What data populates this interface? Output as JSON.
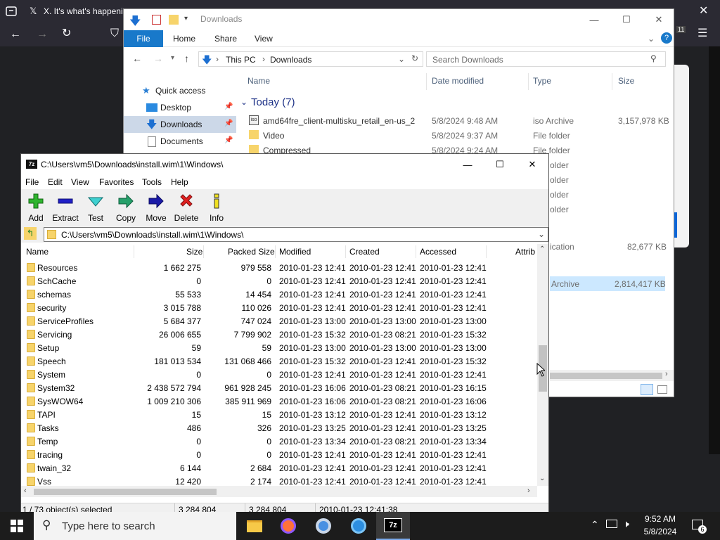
{
  "browser": {
    "tab_title": "X. It's what's happenin",
    "badge_count": "11"
  },
  "explorer": {
    "title": "Downloads",
    "ribbon_tabs": [
      "File",
      "Home",
      "Share",
      "View"
    ],
    "address": [
      "This PC",
      "Downloads"
    ],
    "search_placeholder": "Search Downloads",
    "nav": [
      "Quick access",
      "Desktop",
      "Downloads",
      "Documents"
    ],
    "columns": [
      "Name",
      "Date modified",
      "Type",
      "Size"
    ],
    "group_label": "Today (7)",
    "rows": [
      {
        "name": "amd64fre_client-multisku_retail_en-us_2",
        "date": "5/8/2024 9:48 AM",
        "type": "iso Archive",
        "size": "3,157,978 KB"
      },
      {
        "name": "Video",
        "date": "5/8/2024 9:37 AM",
        "type": "File folder",
        "size": ""
      },
      {
        "name": "Compressed",
        "date": "5/8/2024 9:24 AM",
        "type": "File folder",
        "size": ""
      }
    ],
    "partial_types": [
      "older",
      "older",
      "older",
      "older"
    ],
    "partial_rows": [
      {
        "type": "ication",
        "size": "82,677 KB"
      },
      {
        "type": "Archive",
        "size": "2,814,417 KB"
      }
    ]
  },
  "sevenzip": {
    "title": "C:\\Users\\vm5\\Downloads\\install.wim\\1\\Windows\\",
    "menu": [
      "File",
      "Edit",
      "View",
      "Favorites",
      "Tools",
      "Help"
    ],
    "toolbar": [
      "Add",
      "Extract",
      "Test",
      "Copy",
      "Move",
      "Delete",
      "Info"
    ],
    "address": "C:\\Users\\vm5\\Downloads\\install.wim\\1\\Windows\\",
    "columns": [
      "Name",
      "Size",
      "Packed Size",
      "Modified",
      "Created",
      "Accessed",
      "Attrib"
    ],
    "rows": [
      {
        "name": "Resources",
        "size": "1 662 275",
        "packed": "979 558",
        "modified": "2010-01-23 12:41",
        "created": "2010-01-23 12:41",
        "accessed": "2010-01-23 12:41"
      },
      {
        "name": "SchCache",
        "size": "0",
        "packed": "0",
        "modified": "2010-01-23 12:41",
        "created": "2010-01-23 12:41",
        "accessed": "2010-01-23 12:41"
      },
      {
        "name": "schemas",
        "size": "55 533",
        "packed": "14 454",
        "modified": "2010-01-23 12:41",
        "created": "2010-01-23 12:41",
        "accessed": "2010-01-23 12:41"
      },
      {
        "name": "security",
        "size": "3 015 788",
        "packed": "110 026",
        "modified": "2010-01-23 12:41",
        "created": "2010-01-23 12:41",
        "accessed": "2010-01-23 12:41"
      },
      {
        "name": "ServiceProfiles",
        "size": "5 684 377",
        "packed": "747 024",
        "modified": "2010-01-23 13:00",
        "created": "2010-01-23 13:00",
        "accessed": "2010-01-23 13:00"
      },
      {
        "name": "Servicing",
        "size": "26 006 655",
        "packed": "7 799 902",
        "modified": "2010-01-23 15:32",
        "created": "2010-01-23 08:21",
        "accessed": "2010-01-23 15:32"
      },
      {
        "name": "Setup",
        "size": "59",
        "packed": "59",
        "modified": "2010-01-23 13:00",
        "created": "2010-01-23 13:00",
        "accessed": "2010-01-23 13:00"
      },
      {
        "name": "Speech",
        "size": "181 013 534",
        "packed": "131 068 466",
        "modified": "2010-01-23 15:32",
        "created": "2010-01-23 12:41",
        "accessed": "2010-01-23 15:32"
      },
      {
        "name": "System",
        "size": "0",
        "packed": "0",
        "modified": "2010-01-23 12:41",
        "created": "2010-01-23 12:41",
        "accessed": "2010-01-23 12:41"
      },
      {
        "name": "System32",
        "size": "2 438 572 794",
        "packed": "961 928 245",
        "modified": "2010-01-23 16:06",
        "created": "2010-01-23 08:21",
        "accessed": "2010-01-23 16:15"
      },
      {
        "name": "SysWOW64",
        "size": "1 009 210 306",
        "packed": "385 911 969",
        "modified": "2010-01-23 16:06",
        "created": "2010-01-23 08:21",
        "accessed": "2010-01-23 16:06"
      },
      {
        "name": "TAPI",
        "size": "15",
        "packed": "15",
        "modified": "2010-01-23 13:12",
        "created": "2010-01-23 12:41",
        "accessed": "2010-01-23 13:12"
      },
      {
        "name": "Tasks",
        "size": "486",
        "packed": "326",
        "modified": "2010-01-23 13:25",
        "created": "2010-01-23 12:41",
        "accessed": "2010-01-23 13:25"
      },
      {
        "name": "Temp",
        "size": "0",
        "packed": "0",
        "modified": "2010-01-23 13:34",
        "created": "2010-01-23 08:21",
        "accessed": "2010-01-23 13:34"
      },
      {
        "name": "tracing",
        "size": "0",
        "packed": "0",
        "modified": "2010-01-23 12:41",
        "created": "2010-01-23 12:41",
        "accessed": "2010-01-23 12:41"
      },
      {
        "name": "twain_32",
        "size": "6 144",
        "packed": "2 684",
        "modified": "2010-01-23 12:41",
        "created": "2010-01-23 12:41",
        "accessed": "2010-01-23 12:41"
      },
      {
        "name": "Vss",
        "size": "12 420",
        "packed": "2 174",
        "modified": "2010-01-23 12:41",
        "created": "2010-01-23 12:41",
        "accessed": "2010-01-23 12:41"
      }
    ],
    "status": {
      "selection": "1 / 73 object(s) selected",
      "size": "3 284 804",
      "packed": "3 284 804",
      "date": "2010-01-23 12:41:38"
    }
  },
  "taskbar": {
    "search_placeholder": "Type here to search",
    "time": "9:52 AM",
    "date": "5/8/2024",
    "notification_count": "6"
  }
}
